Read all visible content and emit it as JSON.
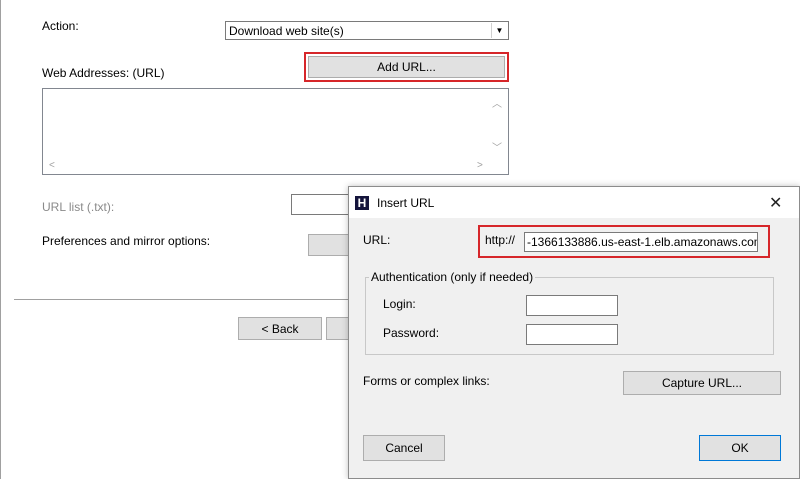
{
  "wizard": {
    "action_label": "Action:",
    "action_value": "Download web site(s)",
    "web_addresses_label": "Web Addresses: (URL)",
    "add_url_button": "Add URL...",
    "url_list_label": "URL list (.txt):",
    "preferences_label": "Preferences and mirror options:",
    "back_button": "< Back",
    "back_mnemonic": "B"
  },
  "dialog": {
    "title": "Insert URL",
    "icon_letter": "H",
    "url_label": "URL:",
    "url_prefix": "http://",
    "url_value": "-1366133886.us-east-1.elb.amazonaws.com",
    "auth_group_label": "Authentication (only if needed)",
    "login_label": "Login:",
    "login_value": "",
    "password_label": "Password:",
    "password_value": "",
    "forms_label": "Forms or complex links:",
    "capture_button": "Capture URL...",
    "cancel_button": "Cancel",
    "ok_button": "OK"
  },
  "colors": {
    "highlight": "#d6262a",
    "focus": "#0078d7",
    "dialog_bg": "#f0f0f0"
  }
}
